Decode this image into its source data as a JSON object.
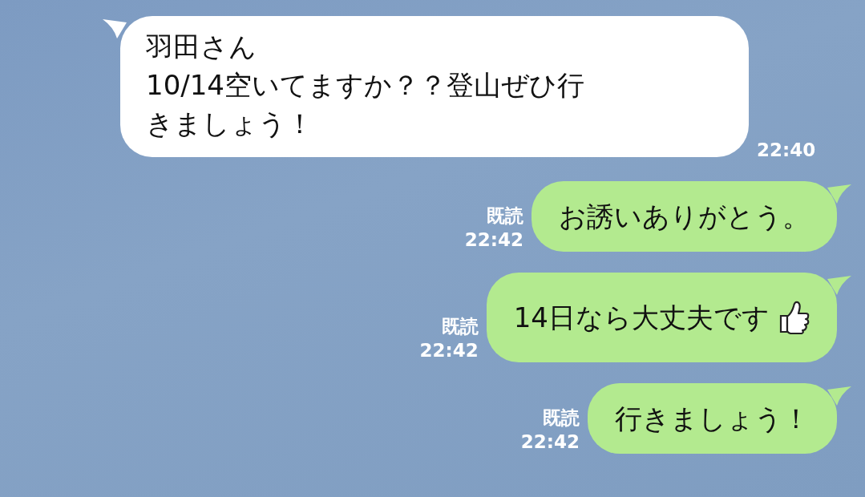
{
  "messages": [
    {
      "kind": "incoming",
      "lines": [
        "羽田さん",
        "10/14空いてますか？？登山ぜひ行",
        "きましょう！"
      ],
      "time": "22:40"
    },
    {
      "kind": "outgoing",
      "lines": [
        "お誘いありがとう。"
      ],
      "read": "既読",
      "time": "22:42",
      "emoji": false
    },
    {
      "kind": "outgoing",
      "lines": [
        "14日なら大丈夫です"
      ],
      "read": "既読",
      "time": "22:42",
      "emoji": true
    },
    {
      "kind": "outgoing",
      "lines": [
        "行きましょう！"
      ],
      "read": "既読",
      "time": "22:42",
      "emoji": false
    }
  ]
}
